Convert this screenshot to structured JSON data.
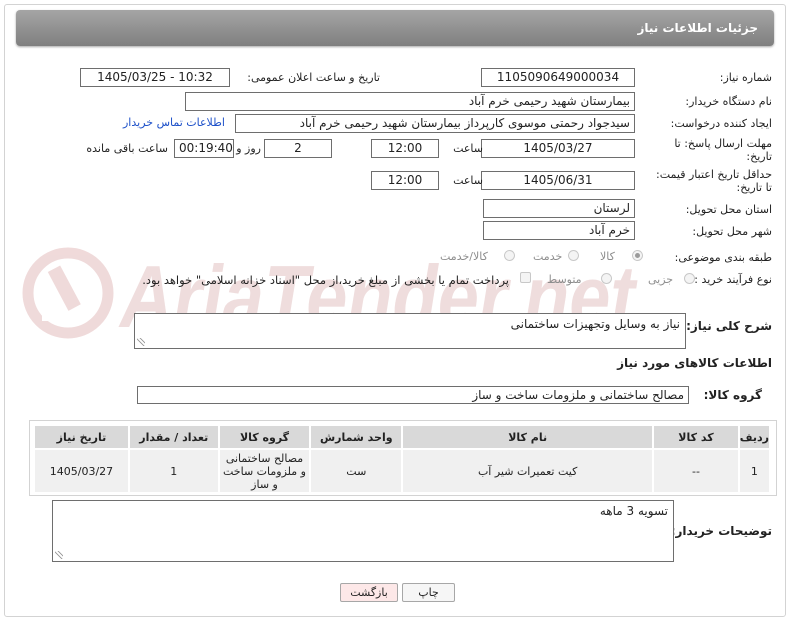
{
  "header": {
    "title": "جزئیات اطلاعات نیاز"
  },
  "fields": {
    "need_number": {
      "label": "شماره نیاز:",
      "value": "1105090649000034"
    },
    "announce_datetime": {
      "label": "تاریخ و ساعت اعلان عمومی:",
      "value": "1405/03/25 - 10:32"
    },
    "buyer_org": {
      "label": "نام دستگاه خریدار:",
      "value": "بیمارستان شهید رحیمی خرم آباد"
    },
    "requester": {
      "label": "ایجاد کننده درخواست:",
      "value": "سیدجواد رحمتی موسوی کارپرداز بیمارستان شهید رحیمی خرم آباد",
      "contact_link": "اطلاعات تماس خریدار"
    },
    "reply_deadline": {
      "label_line1": "مهلت ارسال پاسخ: تا",
      "label_line2": "تاریخ:",
      "date": "1405/03/27",
      "time_label": "ساعت",
      "time": "12:00",
      "days": "2",
      "days_label": "روز و",
      "remaining": "00:19:40",
      "remaining_label": "ساعت باقی مانده"
    },
    "price_validity": {
      "label_line1": "حداقل تاریخ اعتبار قیمت:",
      "label_line2": "تا تاریخ:",
      "date": "1405/06/31",
      "time_label": "ساعت",
      "time": "12:00"
    },
    "delivery_province": {
      "label": "استان محل تحویل:",
      "value": "لرستان"
    },
    "delivery_city": {
      "label": "شهر محل تحویل:",
      "value": "خرم آباد"
    },
    "category": {
      "label": "طبقه بندی موضوعی:",
      "options": [
        "کالا",
        "خدمت",
        "کالا/خدمت"
      ],
      "selected": "کالا"
    },
    "process_type": {
      "label": "نوع فرآیند خرید :",
      "options": [
        "جزیی",
        "متوسط"
      ],
      "selected": "جزیی",
      "payment_note": "پرداخت تمام یا بخشی از مبلغ خرید،از محل \"اسناد خزانه اسلامی\" خواهد بود."
    }
  },
  "description": {
    "label": "شرح کلی نیاز:",
    "value": "نیاز به وسایل وتجهیزات ساختمانی"
  },
  "goods_section": {
    "title": "اطلاعات کالاهای مورد نیاز"
  },
  "goods_group": {
    "label": "گروه کالا:",
    "value": "مصالح ساختمانی و ملزومات ساخت و ساز"
  },
  "table": {
    "headers": [
      "ردیف",
      "کد کالا",
      "نام کالا",
      "واحد شمارش",
      "گروه کالا",
      "تعداد / مقدار",
      "تاریخ نیاز"
    ],
    "rows": [
      [
        "1",
        "--",
        "کیت تعمیرات شیر آب",
        "ست",
        "مصالح ساختمانی و ملزومات ساخت و ساز",
        "1",
        "1405/03/27"
      ]
    ]
  },
  "buyer_notes": {
    "label": "توضیحات خریدار:",
    "value": "تسویه 3 ماهه"
  },
  "buttons": {
    "print": "چاپ",
    "back": "بازگشت"
  },
  "watermark": {
    "text": "AriaTender.net"
  },
  "colors": {
    "header_bg": "#8f8f8f",
    "link": "#1d50c9",
    "back_button_bg": "#fde8e8",
    "watermark": "#e6c7c7"
  }
}
